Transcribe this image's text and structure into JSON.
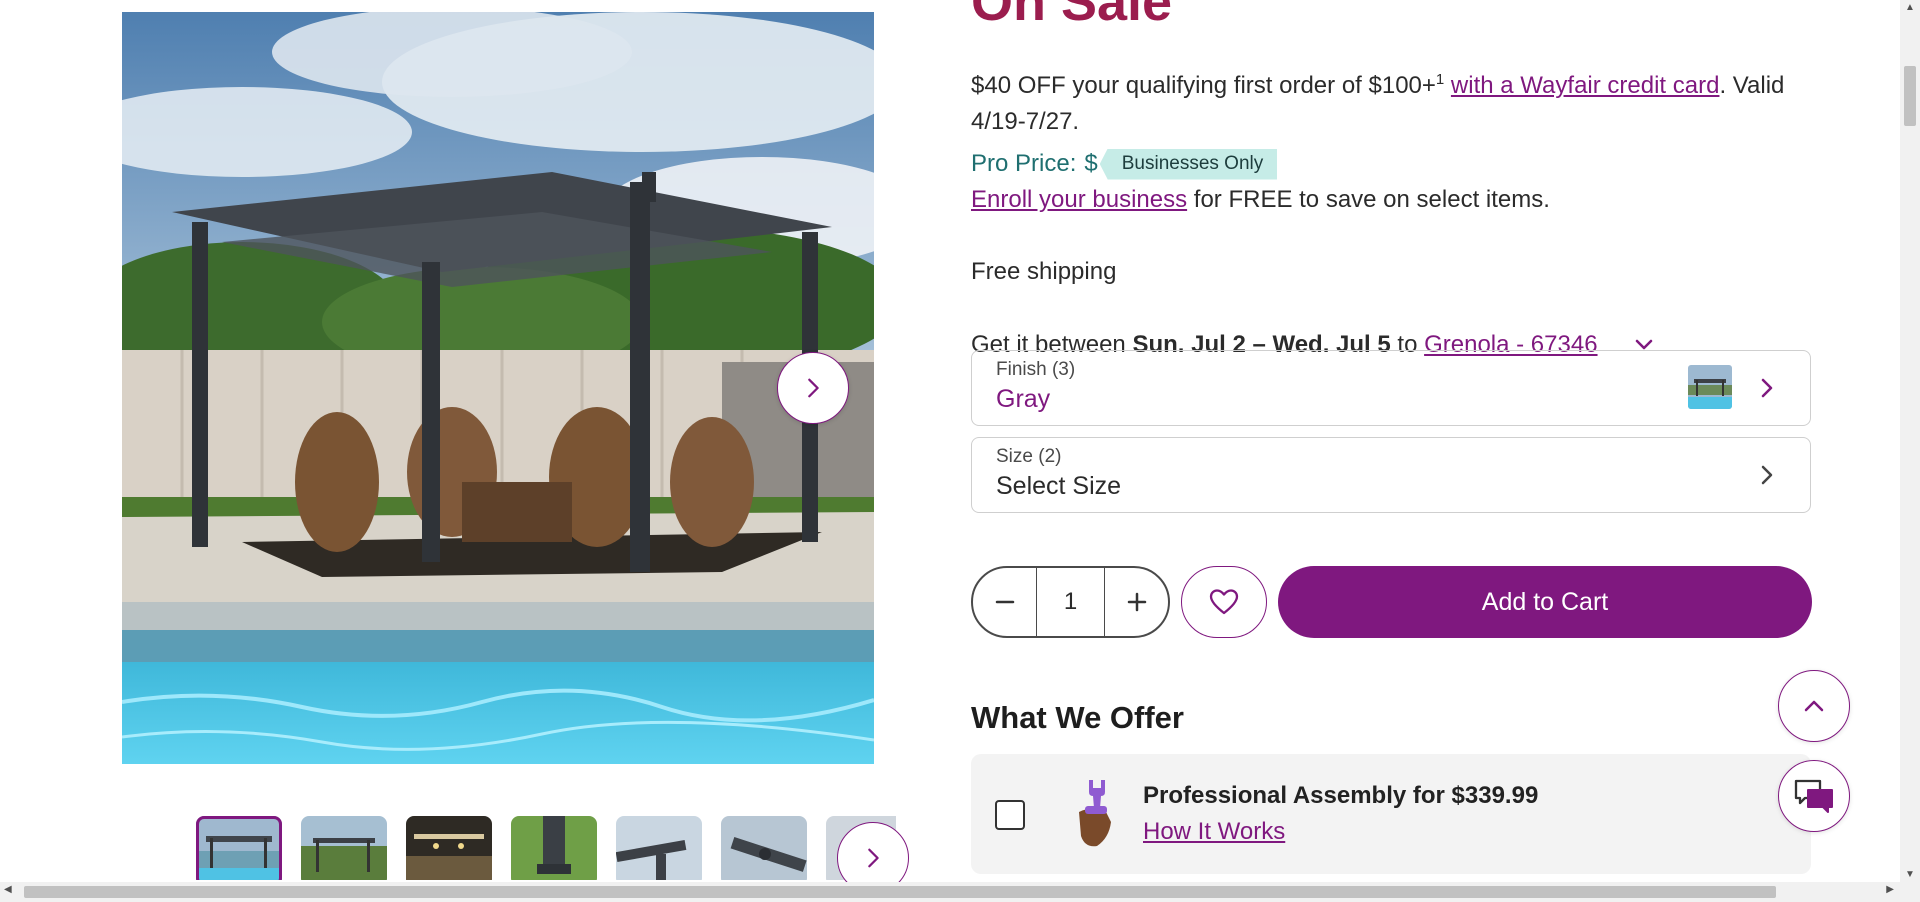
{
  "product": {
    "sale_title": "On Sale"
  },
  "promo": {
    "text": "$40 OFF your qualifying first order of $100+",
    "sup": "1",
    "link": "with a Wayfair credit card",
    "tail": ". Valid 4/19-7/27."
  },
  "pro_price": {
    "label": "Pro Price:",
    "dollar": "$",
    "badge": "Businesses Only",
    "enroll_link": "Enroll your business",
    "enroll_tail": " for FREE to save on select items."
  },
  "shipping": {
    "free": "Free shipping",
    "prefix": "Get it between ",
    "dates": "Sun. Jul 2 – Wed. Jul 5",
    "to": " to ",
    "location": "Grenola - 67346"
  },
  "options": {
    "finish": {
      "label": "Finish (3)",
      "value": "Gray"
    },
    "size": {
      "label": "Size (2)",
      "value": "Select Size"
    }
  },
  "cart": {
    "quantity": "1",
    "add_label": "Add to Cart"
  },
  "offer": {
    "heading": "What We Offer",
    "title": "Professional Assembly for $339.99",
    "link": "How It Works"
  },
  "icons": {
    "gallery_next": "chevron-right-icon",
    "thumbs_next": "chevron-right-icon",
    "location_toggle": "chevron-down-icon",
    "option_chevron": "chevron-right-icon",
    "minus": "minus-icon",
    "plus": "plus-icon",
    "favorite": "heart-icon",
    "scroll_top": "chevron-up-icon",
    "chat": "chat-bubbles-icon",
    "assembly": "wrench-hand-icon"
  },
  "colors": {
    "brand_purple": "#7f187f",
    "sale_red": "#9b1d4e",
    "pro_teal": "#1f6f70",
    "badge_bg": "#c6ece7"
  }
}
